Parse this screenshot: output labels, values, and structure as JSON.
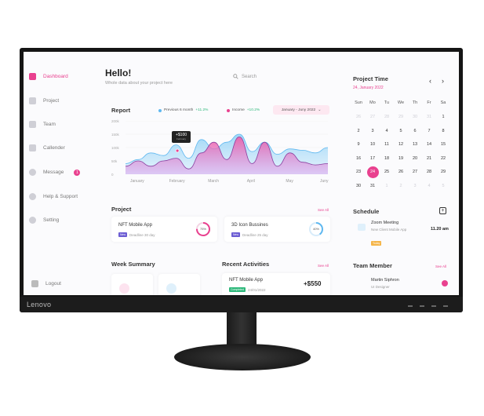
{
  "monitor": {
    "brand": "Lenovo"
  },
  "sidebar": {
    "items": [
      {
        "label": "Dashboard",
        "icon": "dashboard-icon",
        "active": true
      },
      {
        "label": "Project",
        "icon": "project-icon"
      },
      {
        "label": "Team",
        "icon": "team-icon"
      },
      {
        "label": "Callender",
        "icon": "calendar-icon"
      },
      {
        "label": "Message",
        "icon": "message-icon",
        "badge": "1"
      },
      {
        "label": "Help & Support",
        "icon": "help-icon"
      },
      {
        "label": "Setting",
        "icon": "gear-icon"
      }
    ],
    "logout": "Logout"
  },
  "header": {
    "title": "Hello!",
    "subtitle": "Whole data about your project here",
    "search_placeholder": "Search"
  },
  "report": {
    "title": "Report",
    "legend": [
      {
        "name": "Previous 6 month",
        "change": "+11.2%",
        "color": "#5fb8f0"
      },
      {
        "name": "Income",
        "change": "+10.2%",
        "color": "#e9418f"
      }
    ],
    "range": "January - Juny 2022",
    "tooltip": {
      "value": "+$100",
      "sub": "February"
    }
  },
  "chart_data": {
    "type": "area",
    "categories": [
      "January",
      "February",
      "March",
      "April",
      "May",
      "Juny"
    ],
    "y_ticks": [
      "200k",
      "150k",
      "100k",
      "50k",
      "0"
    ],
    "ylim": [
      0,
      200
    ],
    "series": [
      {
        "name": "Previous 6 month",
        "values": [
          40,
          55,
          80,
          70,
          110,
          60,
          130,
          95,
          120,
          150,
          85,
          120,
          75,
          95,
          90,
          80,
          100
        ]
      },
      {
        "name": "Income",
        "values": [
          30,
          50,
          30,
          50,
          60,
          20,
          80,
          120,
          55,
          140,
          40,
          120,
          30,
          80,
          45,
          35,
          40
        ]
      }
    ],
    "grid": true
  },
  "project": {
    "title": "Project",
    "see_all": "See All",
    "items": [
      {
        "name": "NFT Mobile App",
        "tag": "New",
        "deadline": "Deadline 30 day",
        "progress": "75%",
        "color": "#e9418f",
        "fraction": 0.75
      },
      {
        "name": "3D Icon Bussines",
        "tag": "New",
        "deadline": "Deadline 25 day",
        "progress": "40%",
        "color": "#5fb8f0",
        "fraction": 0.4
      }
    ]
  },
  "week_summary": {
    "title": "Week Summary"
  },
  "recent": {
    "title": "Recent Activities",
    "see_all": "See All",
    "item": {
      "name": "NFT Mobile App",
      "status": "Completed",
      "date": "24/01/2022",
      "amount": "+$550"
    }
  },
  "calendar": {
    "title": "Project Time",
    "date": "24, January 2022",
    "dow": [
      "Sun",
      "Mo",
      "Tu",
      "We",
      "Th",
      "Fr",
      "Sa"
    ],
    "weeks": [
      [
        "26",
        "27",
        "28",
        "29",
        "30",
        "31",
        "1"
      ],
      [
        "2",
        "3",
        "4",
        "5",
        "6",
        "7",
        "8"
      ],
      [
        "9",
        "10",
        "11",
        "12",
        "13",
        "14",
        "15"
      ],
      [
        "16",
        "17",
        "18",
        "19",
        "20",
        "21",
        "22"
      ],
      [
        "23",
        "24",
        "25",
        "26",
        "27",
        "28",
        "29"
      ],
      [
        "30",
        "31",
        "1",
        "2",
        "3",
        "4",
        "5"
      ]
    ],
    "selected": "24"
  },
  "schedule": {
    "title": "Schedule",
    "event": {
      "title": "Zoom Meeting",
      "subtitle": "New Client Mobile App",
      "tag": "Today",
      "time": "11.20 am"
    }
  },
  "team": {
    "title": "Team Member",
    "see_all": "See All",
    "member": {
      "name": "Martin Siphron",
      "role": "UI Designer"
    }
  }
}
